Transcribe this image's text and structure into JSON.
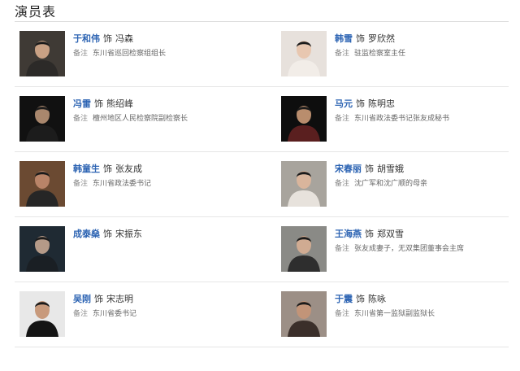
{
  "section": {
    "title": "演员表"
  },
  "cast": [
    {
      "left": {
        "actor": "于和伟",
        "as": "饰",
        "role": "冯森",
        "note_label": "备注",
        "note": "东川省巡回检察组组长",
        "bg": "#3f3a35",
        "face": "#c9a184",
        "suit": "#2c2a28"
      },
      "right": {
        "actor": "韩雪",
        "as": "饰",
        "role": "罗欣然",
        "note_label": "备注",
        "note": "驻监检察室主任",
        "bg": "#e7e1dc",
        "face": "#e8c7b0",
        "suit": "#f2ede8"
      }
    },
    {
      "left": {
        "actor": "冯雷",
        "as": "饰",
        "role": "熊绍峰",
        "note_label": "备注",
        "note": "檀州地区人民检察院副检察长",
        "bg": "#111111",
        "face": "#a9876d",
        "suit": "#1c1c1c"
      },
      "right": {
        "actor": "马元",
        "as": "饰",
        "role": "陈明忠",
        "note_label": "备注",
        "note": "东川省政法委书记张友成秘书",
        "bg": "#0e0e0e",
        "face": "#b98d6d",
        "suit": "#5a1f1f"
      }
    },
    {
      "left": {
        "actor": "韩童生",
        "as": "饰",
        "role": "张友成",
        "note_label": "备注",
        "note": "东川省政法委书记",
        "bg": "#6b4a32",
        "face": "#b98468",
        "suit": "#262626"
      },
      "right": {
        "actor": "宋春丽",
        "as": "饰",
        "role": "胡雪娥",
        "note_label": "备注",
        "note": "沈广军和沈广顺的母亲",
        "bg": "#a8a49d",
        "face": "#d9b59c",
        "suit": "#e7e2dc"
      }
    },
    {
      "left": {
        "actor": "成泰燊",
        "as": "饰",
        "role": "宋振东",
        "note_label": "",
        "note": "",
        "bg": "#1f2a33",
        "face": "#b59a88",
        "suit": "#1a1f24"
      },
      "right": {
        "actor": "王海燕",
        "as": "饰",
        "role": "郑双雪",
        "note_label": "备注",
        "note": "张友成妻子，无双集团董事会主席",
        "bg": "#8a8a86",
        "face": "#d0ab92",
        "suit": "#2e2e2e"
      }
    },
    {
      "left": {
        "actor": "吴刚",
        "as": "饰",
        "role": "宋志明",
        "note_label": "备注",
        "note": "东川省委书记",
        "bg": "#e8e8e8",
        "face": "#c89a7c",
        "suit": "#141414"
      },
      "right": {
        "actor": "于震",
        "as": "饰",
        "role": "陈咏",
        "note_label": "备注",
        "note": "东川省第一监狱副监狱长",
        "bg": "#9c8f86",
        "face": "#c29478",
        "suit": "#3b2f2a"
      }
    }
  ]
}
